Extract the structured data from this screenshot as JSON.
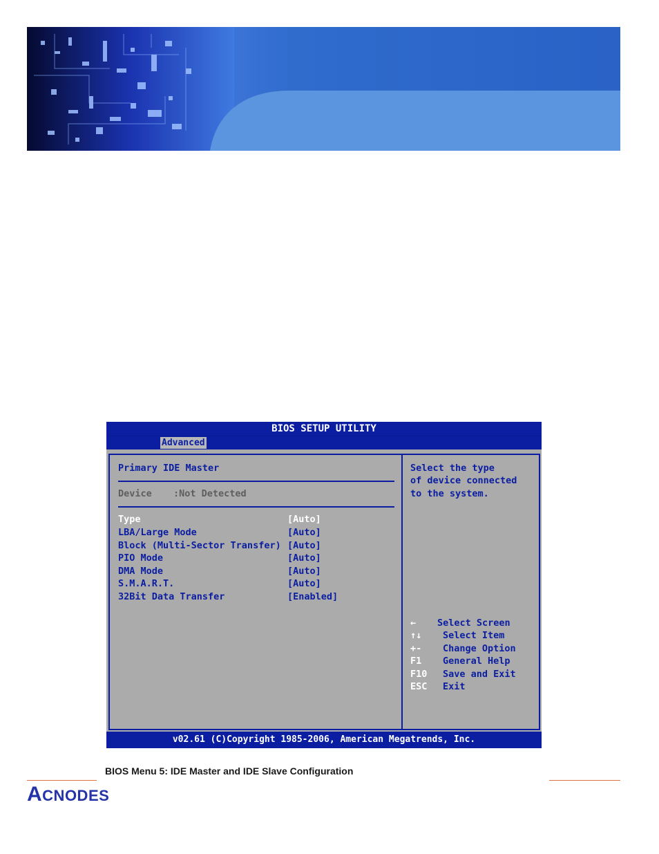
{
  "bios": {
    "title": "BIOS SETUP UTILITY",
    "active_tab": "Advanced",
    "section_title": "Primary IDE Master",
    "device_label": "Device",
    "device_value": ":Not Detected",
    "settings": [
      {
        "label": "Type",
        "value": "[Auto]"
      },
      {
        "label": "LBA/Large Mode",
        "value": "[Auto]"
      },
      {
        "label": "Block (Multi-Sector Transfer)",
        "value": "[Auto]"
      },
      {
        "label": "PIO Mode",
        "value": "[Auto]"
      },
      {
        "label": "DMA Mode",
        "value": "[Auto]"
      },
      {
        "label": "S.M.A.R.T.",
        "value": "[Auto]"
      },
      {
        "label": "32Bit Data Transfer",
        "value": "[Enabled]"
      }
    ],
    "help_lines": [
      "Select the type",
      "of device connected",
      "to the system."
    ],
    "keys": [
      {
        "key": "←",
        "action": "Select Screen"
      },
      {
        "key": "↑↓",
        "action": "Select Item"
      },
      {
        "key": "+-",
        "action": "Change Option"
      },
      {
        "key": "F1",
        "action": "General Help"
      },
      {
        "key": "F10",
        "action": "Save and Exit"
      },
      {
        "key": "ESC",
        "action": "Exit"
      }
    ],
    "footer": "v02.61 (C)Copyright 1985-2006, American Megatrends, Inc."
  },
  "caption": "BIOS Menu 5: IDE Master and IDE Slave Configuration",
  "logo": {
    "text_a": "A",
    "text_rest": "CNODES"
  },
  "colors": {
    "bios_blue": "#0b1ea2",
    "bios_gray": "#ababab",
    "accent_rule": "#e07040",
    "logo_blue": "#2433a8"
  }
}
